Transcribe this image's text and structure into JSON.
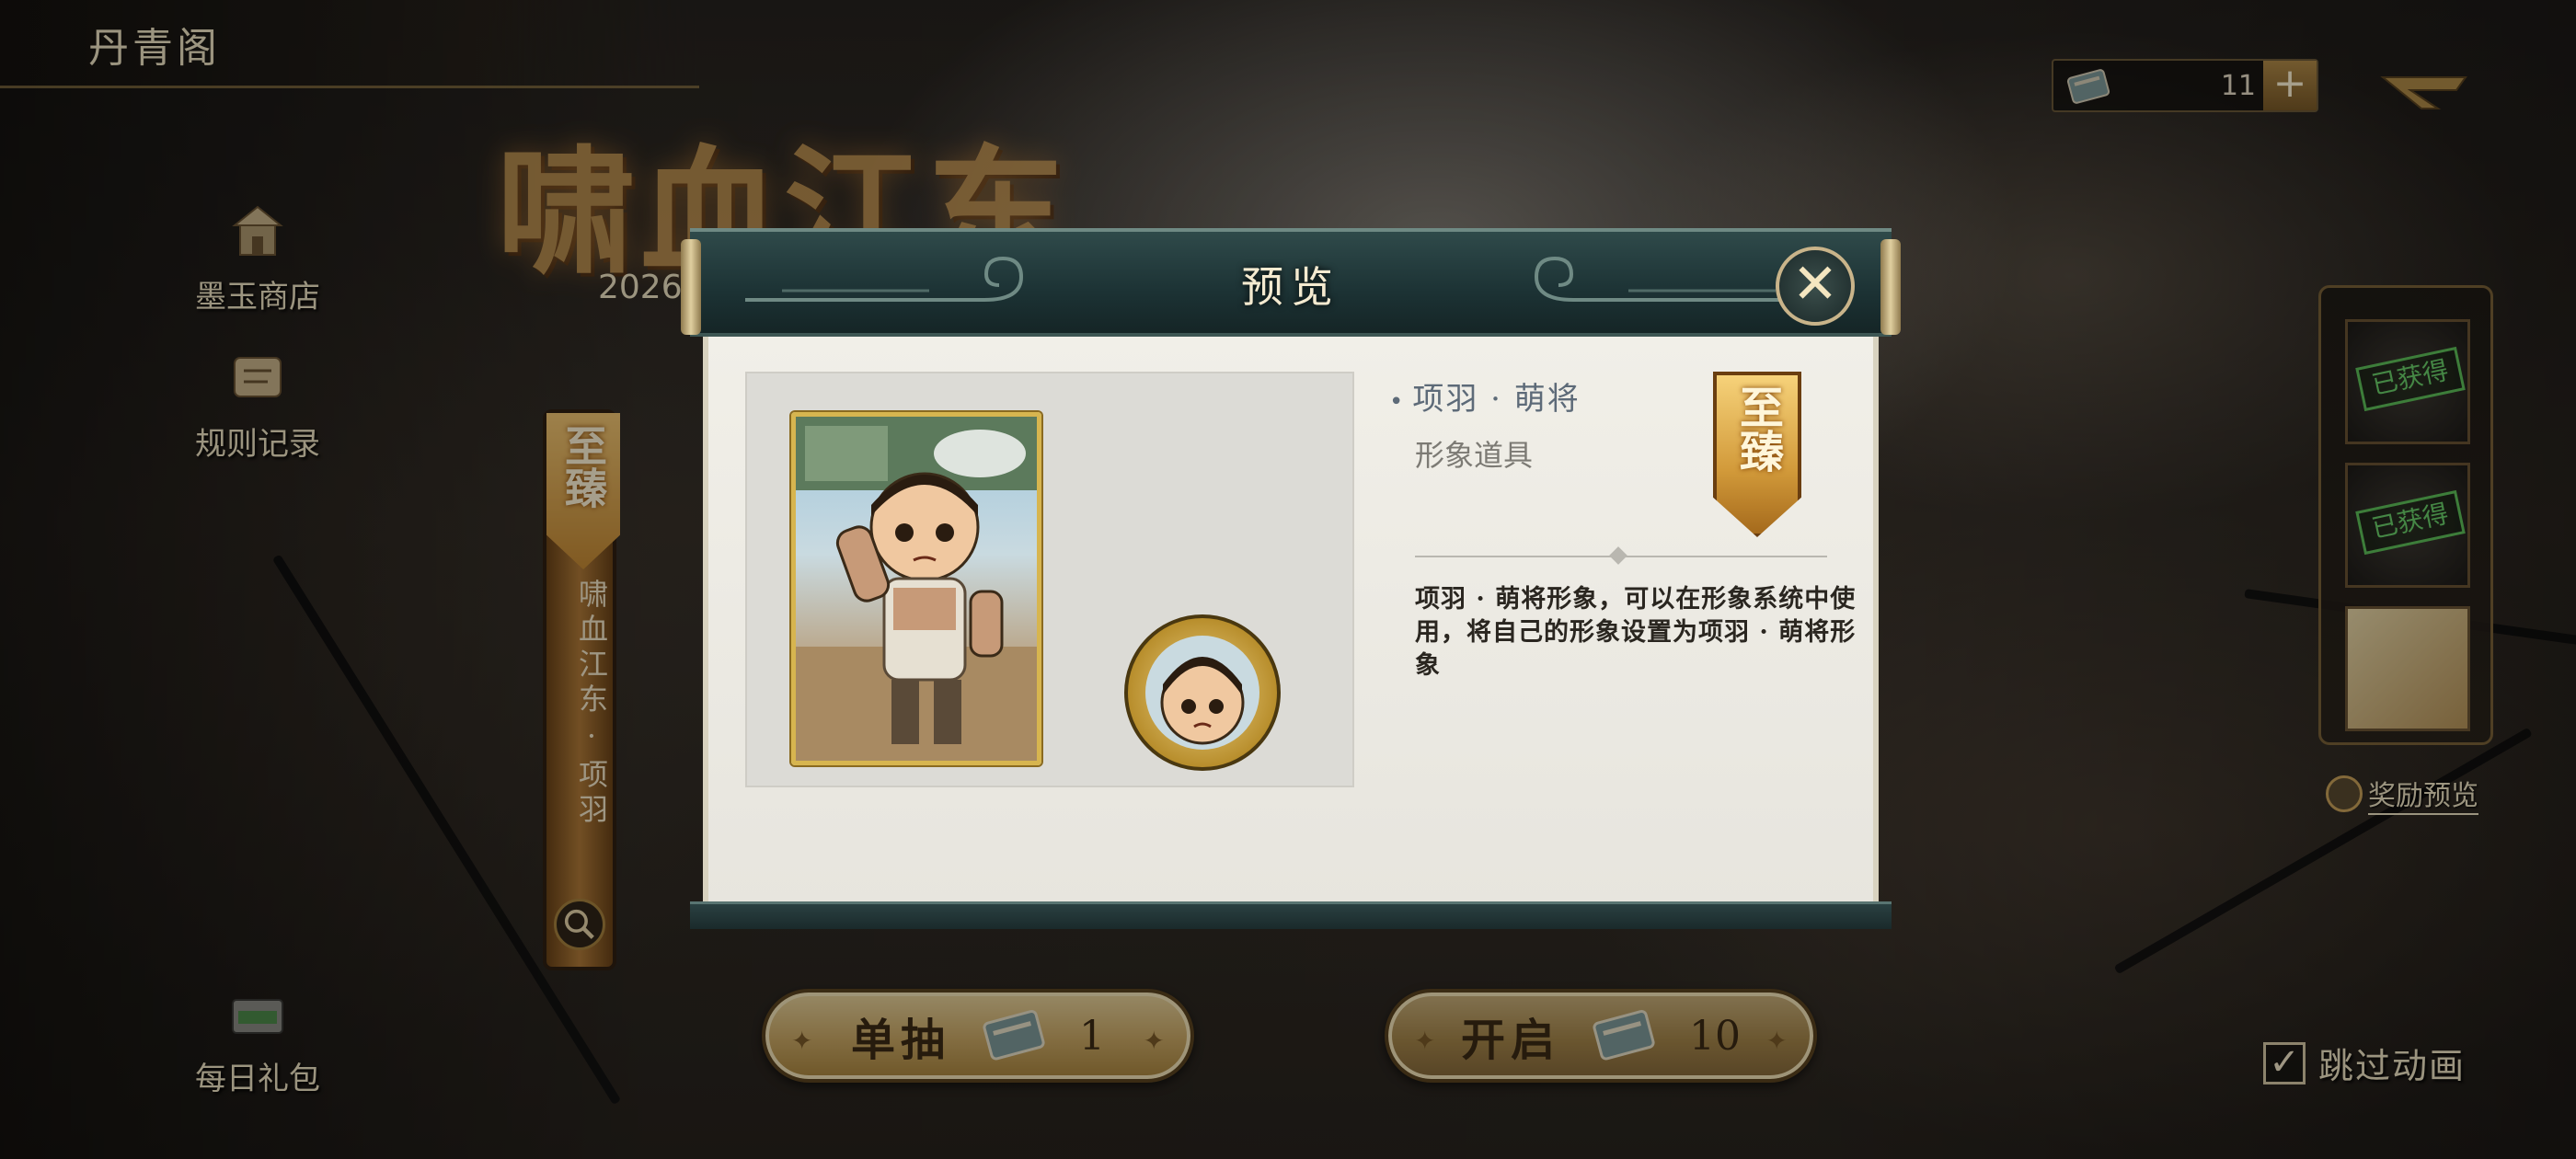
{
  "top_bar": {
    "title": "丹青阁"
  },
  "currency": {
    "count": "11",
    "plus_label": "+"
  },
  "banner": {
    "title": "啸血江东",
    "year": "2026"
  },
  "left_menu": [
    {
      "label": "墨玉商店",
      "icon": "shop-icon"
    },
    {
      "label": "规则记录",
      "icon": "rules-scroll-icon"
    },
    {
      "label": "每日礼包",
      "icon": "gift-chest-icon"
    }
  ],
  "side_banner": {
    "badge": "至臻",
    "text": "啸血江东·项羽"
  },
  "rewards": {
    "obtained_label": "已获得",
    "preview_label": "奖励预览"
  },
  "draw_buttons": {
    "single": {
      "label": "单抽",
      "cost": "1"
    },
    "ten": {
      "label": "开启",
      "cost": "10"
    }
  },
  "skip_animation": {
    "label": "跳过动画",
    "checked": true,
    "check_glyph": "✓"
  },
  "modal": {
    "title": "预览",
    "close_glyph": "✕",
    "item_name": "项羽 · 萌将",
    "item_type": "形象道具",
    "rarity": "至臻",
    "description": "项羽 · 萌将形象，可以在形象系统中使用，将自己的形象设置为项羽 · 萌将形象"
  },
  "colors": {
    "accent_gold": "#c9a764",
    "modal_header": "#1c3234",
    "modal_body": "#f1efe8",
    "obtained_green": "#6ad06a"
  }
}
